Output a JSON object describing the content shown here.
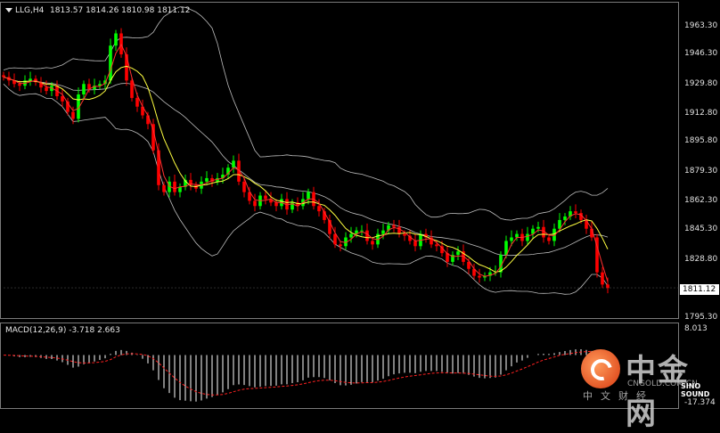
{
  "chart_header": {
    "symbol_period": "LLG,H4",
    "ohlc": "1813.57 1814.26 1810.98 1811.12"
  },
  "price_axis": {
    "labels": [
      "1963.30",
      "1946.30",
      "1929.80",
      "1912.80",
      "1895.80",
      "1879.30",
      "1862.30",
      "1845.30",
      "1828.80",
      "1795.30"
    ],
    "current_price": "1811.12"
  },
  "macd": {
    "label": "MACD(12,26,9) -3.718 2.663",
    "axis_top": "8.013",
    "axis_bottom": "-17.374"
  },
  "watermark": {
    "brand": "中金网",
    "url": "CNGOLD.COM.CN",
    "sub": "中文财经",
    "sub2": "SINO SOUND"
  },
  "colors": {
    "bull": "#00ff00",
    "bear": "#ff0000",
    "ma_fast": "#ff3030",
    "ma_slow": "#ffff40",
    "bands": "#bdbdbd",
    "macd_hist": "#ffffff",
    "macd_signal": "#ff2020"
  },
  "chart_data": {
    "type": "candlestick",
    "ylim": [
      1795.3,
      1969.0
    ],
    "series": [
      {
        "name": "close",
        "values": [
          1932,
          1930,
          1928,
          1927,
          1930,
          1931,
          1929,
          1926,
          1924,
          1927,
          1921,
          1918,
          1912,
          1908,
          1922,
          1928,
          1925,
          1927,
          1928,
          1930,
          1950,
          1957,
          1945,
          1930,
          1920,
          1915,
          1910,
          1905,
          1890,
          1870,
          1866,
          1872,
          1866,
          1869,
          1873,
          1870,
          1868,
          1872,
          1874,
          1872,
          1874,
          1876,
          1880,
          1884,
          1872,
          1866,
          1861,
          1858,
          1864,
          1862,
          1860,
          1858,
          1862,
          1856,
          1860,
          1858,
          1862,
          1866,
          1858,
          1855,
          1850,
          1842,
          1836,
          1835,
          1840,
          1842,
          1844,
          1844,
          1838,
          1836,
          1842,
          1844,
          1847,
          1846,
          1842,
          1841,
          1838,
          1835,
          1842,
          1840,
          1836,
          1835,
          1831,
          1826,
          1830,
          1832,
          1826,
          1822,
          1818,
          1817,
          1818,
          1820,
          1820,
          1830,
          1838,
          1840,
          1842,
          1838,
          1842,
          1845,
          1846,
          1840,
          1838,
          1845,
          1850,
          1852,
          1855,
          1854,
          1850,
          1845,
          1840,
          1820,
          1813,
          1811
        ]
      }
    ]
  }
}
